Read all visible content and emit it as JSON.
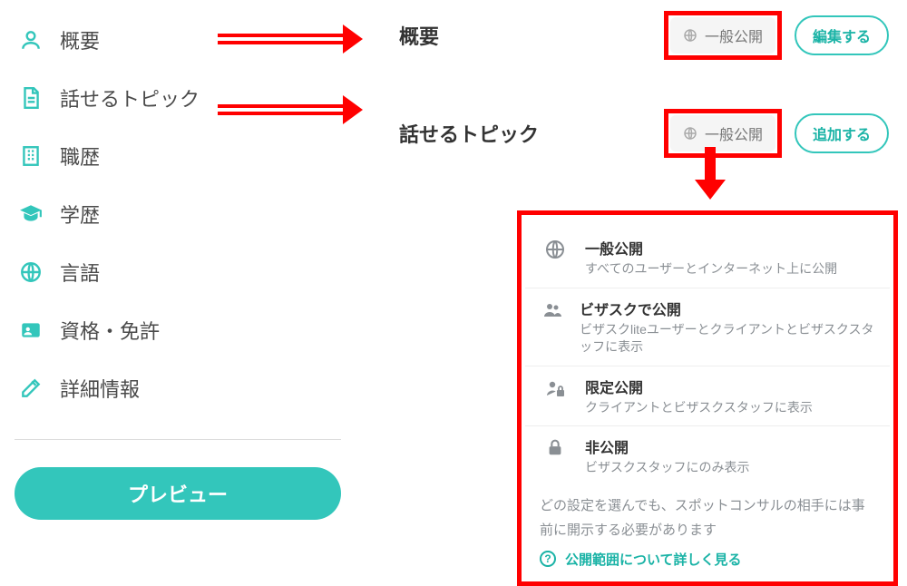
{
  "sidebar": {
    "items": [
      {
        "label": "概要",
        "icon": "user-icon"
      },
      {
        "label": "話せるトピック",
        "icon": "document-icon"
      },
      {
        "label": "職歴",
        "icon": "building-icon"
      },
      {
        "label": "学歴",
        "icon": "graduation-icon"
      },
      {
        "label": "言語",
        "icon": "globe-icon"
      },
      {
        "label": "資格・免許",
        "icon": "id-card-icon"
      },
      {
        "label": "詳細情報",
        "icon": "edit-icon"
      }
    ],
    "preview_label": "プレビュー"
  },
  "sections": {
    "overview": {
      "title": "概要",
      "visibility": "一般公開",
      "action": "編集する"
    },
    "topics": {
      "title": "話せるトピック",
      "visibility": "一般公開",
      "action": "追加する"
    }
  },
  "visibility_options": [
    {
      "title": "一般公開",
      "desc": "すべてのユーザーとインターネット上に公開",
      "icon": "globe-icon"
    },
    {
      "title": "ビザスクで公開",
      "desc": "ビザスクliteユーザーとクライアントとビザスクスタッフに表示",
      "icon": "people-icon"
    },
    {
      "title": "限定公開",
      "desc": "クライアントとビザスクスタッフに表示",
      "icon": "person-lock-icon"
    },
    {
      "title": "非公開",
      "desc": "ビザスクスタッフにのみ表示",
      "icon": "lock-icon"
    }
  ],
  "visibility_note": "どの設定を選んでも、スポットコンサルの相手には事前に開示する必要があります",
  "learn_more": "公開範囲について詳しく見る",
  "annotations": {
    "highlight_color": "#ff0000"
  }
}
